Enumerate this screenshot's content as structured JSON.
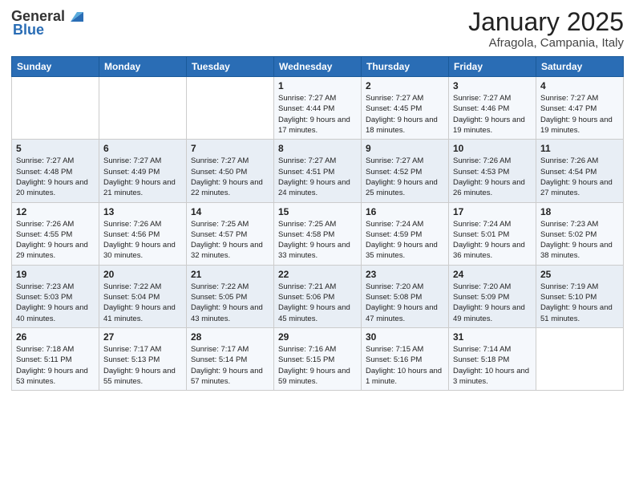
{
  "logo": {
    "general": "General",
    "blue": "Blue"
  },
  "header": {
    "month": "January 2025",
    "location": "Afragola, Campania, Italy"
  },
  "weekdays": [
    "Sunday",
    "Monday",
    "Tuesday",
    "Wednesday",
    "Thursday",
    "Friday",
    "Saturday"
  ],
  "weeks": [
    [
      {
        "day": "",
        "sunrise": "",
        "sunset": "",
        "daylight": ""
      },
      {
        "day": "",
        "sunrise": "",
        "sunset": "",
        "daylight": ""
      },
      {
        "day": "",
        "sunrise": "",
        "sunset": "",
        "daylight": ""
      },
      {
        "day": "1",
        "sunrise": "Sunrise: 7:27 AM",
        "sunset": "Sunset: 4:44 PM",
        "daylight": "Daylight: 9 hours and 17 minutes."
      },
      {
        "day": "2",
        "sunrise": "Sunrise: 7:27 AM",
        "sunset": "Sunset: 4:45 PM",
        "daylight": "Daylight: 9 hours and 18 minutes."
      },
      {
        "day": "3",
        "sunrise": "Sunrise: 7:27 AM",
        "sunset": "Sunset: 4:46 PM",
        "daylight": "Daylight: 9 hours and 19 minutes."
      },
      {
        "day": "4",
        "sunrise": "Sunrise: 7:27 AM",
        "sunset": "Sunset: 4:47 PM",
        "daylight": "Daylight: 9 hours and 19 minutes."
      }
    ],
    [
      {
        "day": "5",
        "sunrise": "Sunrise: 7:27 AM",
        "sunset": "Sunset: 4:48 PM",
        "daylight": "Daylight: 9 hours and 20 minutes."
      },
      {
        "day": "6",
        "sunrise": "Sunrise: 7:27 AM",
        "sunset": "Sunset: 4:49 PM",
        "daylight": "Daylight: 9 hours and 21 minutes."
      },
      {
        "day": "7",
        "sunrise": "Sunrise: 7:27 AM",
        "sunset": "Sunset: 4:50 PM",
        "daylight": "Daylight: 9 hours and 22 minutes."
      },
      {
        "day": "8",
        "sunrise": "Sunrise: 7:27 AM",
        "sunset": "Sunset: 4:51 PM",
        "daylight": "Daylight: 9 hours and 24 minutes."
      },
      {
        "day": "9",
        "sunrise": "Sunrise: 7:27 AM",
        "sunset": "Sunset: 4:52 PM",
        "daylight": "Daylight: 9 hours and 25 minutes."
      },
      {
        "day": "10",
        "sunrise": "Sunrise: 7:26 AM",
        "sunset": "Sunset: 4:53 PM",
        "daylight": "Daylight: 9 hours and 26 minutes."
      },
      {
        "day": "11",
        "sunrise": "Sunrise: 7:26 AM",
        "sunset": "Sunset: 4:54 PM",
        "daylight": "Daylight: 9 hours and 27 minutes."
      }
    ],
    [
      {
        "day": "12",
        "sunrise": "Sunrise: 7:26 AM",
        "sunset": "Sunset: 4:55 PM",
        "daylight": "Daylight: 9 hours and 29 minutes."
      },
      {
        "day": "13",
        "sunrise": "Sunrise: 7:26 AM",
        "sunset": "Sunset: 4:56 PM",
        "daylight": "Daylight: 9 hours and 30 minutes."
      },
      {
        "day": "14",
        "sunrise": "Sunrise: 7:25 AM",
        "sunset": "Sunset: 4:57 PM",
        "daylight": "Daylight: 9 hours and 32 minutes."
      },
      {
        "day": "15",
        "sunrise": "Sunrise: 7:25 AM",
        "sunset": "Sunset: 4:58 PM",
        "daylight": "Daylight: 9 hours and 33 minutes."
      },
      {
        "day": "16",
        "sunrise": "Sunrise: 7:24 AM",
        "sunset": "Sunset: 4:59 PM",
        "daylight": "Daylight: 9 hours and 35 minutes."
      },
      {
        "day": "17",
        "sunrise": "Sunrise: 7:24 AM",
        "sunset": "Sunset: 5:01 PM",
        "daylight": "Daylight: 9 hours and 36 minutes."
      },
      {
        "day": "18",
        "sunrise": "Sunrise: 7:23 AM",
        "sunset": "Sunset: 5:02 PM",
        "daylight": "Daylight: 9 hours and 38 minutes."
      }
    ],
    [
      {
        "day": "19",
        "sunrise": "Sunrise: 7:23 AM",
        "sunset": "Sunset: 5:03 PM",
        "daylight": "Daylight: 9 hours and 40 minutes."
      },
      {
        "day": "20",
        "sunrise": "Sunrise: 7:22 AM",
        "sunset": "Sunset: 5:04 PM",
        "daylight": "Daylight: 9 hours and 41 minutes."
      },
      {
        "day": "21",
        "sunrise": "Sunrise: 7:22 AM",
        "sunset": "Sunset: 5:05 PM",
        "daylight": "Daylight: 9 hours and 43 minutes."
      },
      {
        "day": "22",
        "sunrise": "Sunrise: 7:21 AM",
        "sunset": "Sunset: 5:06 PM",
        "daylight": "Daylight: 9 hours and 45 minutes."
      },
      {
        "day": "23",
        "sunrise": "Sunrise: 7:20 AM",
        "sunset": "Sunset: 5:08 PM",
        "daylight": "Daylight: 9 hours and 47 minutes."
      },
      {
        "day": "24",
        "sunrise": "Sunrise: 7:20 AM",
        "sunset": "Sunset: 5:09 PM",
        "daylight": "Daylight: 9 hours and 49 minutes."
      },
      {
        "day": "25",
        "sunrise": "Sunrise: 7:19 AM",
        "sunset": "Sunset: 5:10 PM",
        "daylight": "Daylight: 9 hours and 51 minutes."
      }
    ],
    [
      {
        "day": "26",
        "sunrise": "Sunrise: 7:18 AM",
        "sunset": "Sunset: 5:11 PM",
        "daylight": "Daylight: 9 hours and 53 minutes."
      },
      {
        "day": "27",
        "sunrise": "Sunrise: 7:17 AM",
        "sunset": "Sunset: 5:13 PM",
        "daylight": "Daylight: 9 hours and 55 minutes."
      },
      {
        "day": "28",
        "sunrise": "Sunrise: 7:17 AM",
        "sunset": "Sunset: 5:14 PM",
        "daylight": "Daylight: 9 hours and 57 minutes."
      },
      {
        "day": "29",
        "sunrise": "Sunrise: 7:16 AM",
        "sunset": "Sunset: 5:15 PM",
        "daylight": "Daylight: 9 hours and 59 minutes."
      },
      {
        "day": "30",
        "sunrise": "Sunrise: 7:15 AM",
        "sunset": "Sunset: 5:16 PM",
        "daylight": "Daylight: 10 hours and 1 minute."
      },
      {
        "day": "31",
        "sunrise": "Sunrise: 7:14 AM",
        "sunset": "Sunset: 5:18 PM",
        "daylight": "Daylight: 10 hours and 3 minutes."
      },
      {
        "day": "",
        "sunrise": "",
        "sunset": "",
        "daylight": ""
      }
    ]
  ]
}
